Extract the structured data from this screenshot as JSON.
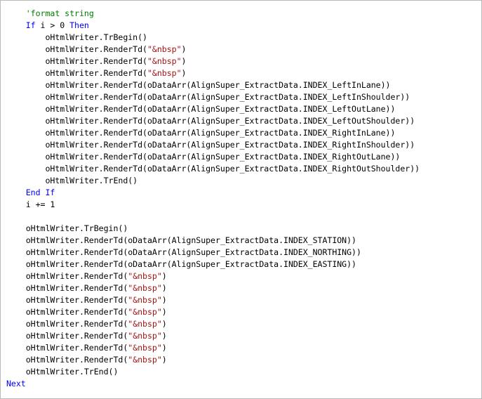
{
  "editor": {
    "lines": [
      [
        {
          "t": "    ",
          "k": "plain"
        },
        {
          "t": "'format string",
          "k": "comment"
        }
      ],
      [
        {
          "t": "    ",
          "k": "plain"
        },
        {
          "t": "If",
          "k": "keyword"
        },
        {
          "t": " i > 0 ",
          "k": "plain"
        },
        {
          "t": "Then",
          "k": "keyword"
        }
      ],
      [
        {
          "t": "        oHtmlWriter.TrBegin()",
          "k": "plain"
        }
      ],
      [
        {
          "t": "        oHtmlWriter.RenderTd(",
          "k": "plain"
        },
        {
          "t": "\"&nbsp\"",
          "k": "string"
        },
        {
          "t": ")",
          "k": "plain"
        }
      ],
      [
        {
          "t": "        oHtmlWriter.RenderTd(",
          "k": "plain"
        },
        {
          "t": "\"&nbsp\"",
          "k": "string"
        },
        {
          "t": ")",
          "k": "plain"
        }
      ],
      [
        {
          "t": "        oHtmlWriter.RenderTd(",
          "k": "plain"
        },
        {
          "t": "\"&nbsp\"",
          "k": "string"
        },
        {
          "t": ")",
          "k": "plain"
        }
      ],
      [
        {
          "t": "        oHtmlWriter.RenderTd(oDataArr(AlignSuper_ExtractData.INDEX_LeftInLane))",
          "k": "plain"
        }
      ],
      [
        {
          "t": "        oHtmlWriter.RenderTd(oDataArr(AlignSuper_ExtractData.INDEX_LeftInShoulder))",
          "k": "plain"
        }
      ],
      [
        {
          "t": "        oHtmlWriter.RenderTd(oDataArr(AlignSuper_ExtractData.INDEX_LeftOutLane))",
          "k": "plain"
        }
      ],
      [
        {
          "t": "        oHtmlWriter.RenderTd(oDataArr(AlignSuper_ExtractData.INDEX_LeftOutShoulder))",
          "k": "plain"
        }
      ],
      [
        {
          "t": "        oHtmlWriter.RenderTd(oDataArr(AlignSuper_ExtractData.INDEX_RightInLane))",
          "k": "plain"
        }
      ],
      [
        {
          "t": "        oHtmlWriter.RenderTd(oDataArr(AlignSuper_ExtractData.INDEX_RightInShoulder))",
          "k": "plain"
        }
      ],
      [
        {
          "t": "        oHtmlWriter.RenderTd(oDataArr(AlignSuper_ExtractData.INDEX_RightOutLane))",
          "k": "plain"
        }
      ],
      [
        {
          "t": "        oHtmlWriter.RenderTd(oDataArr(AlignSuper_ExtractData.INDEX_RightOutShoulder))",
          "k": "plain"
        }
      ],
      [
        {
          "t": "        oHtmlWriter.TrEnd()",
          "k": "plain"
        }
      ],
      [
        {
          "t": "    ",
          "k": "plain"
        },
        {
          "t": "End If",
          "k": "keyword"
        }
      ],
      [
        {
          "t": "    i += 1",
          "k": "plain"
        }
      ],
      [
        {
          "t": "",
          "k": "plain"
        }
      ],
      [
        {
          "t": "    oHtmlWriter.TrBegin()",
          "k": "plain"
        }
      ],
      [
        {
          "t": "    oHtmlWriter.RenderTd(oDataArr(AlignSuper_ExtractData.INDEX_STATION))",
          "k": "plain"
        }
      ],
      [
        {
          "t": "    oHtmlWriter.RenderTd(oDataArr(AlignSuper_ExtractData.INDEX_NORTHING))",
          "k": "plain"
        }
      ],
      [
        {
          "t": "    oHtmlWriter.RenderTd(oDataArr(AlignSuper_ExtractData.INDEX_EASTING))",
          "k": "plain"
        }
      ],
      [
        {
          "t": "    oHtmlWriter.RenderTd(",
          "k": "plain"
        },
        {
          "t": "\"&nbsp\"",
          "k": "string"
        },
        {
          "t": ")",
          "k": "plain"
        }
      ],
      [
        {
          "t": "    oHtmlWriter.RenderTd(",
          "k": "plain"
        },
        {
          "t": "\"&nbsp\"",
          "k": "string"
        },
        {
          "t": ")",
          "k": "plain"
        }
      ],
      [
        {
          "t": "    oHtmlWriter.RenderTd(",
          "k": "plain"
        },
        {
          "t": "\"&nbsp\"",
          "k": "string"
        },
        {
          "t": ")",
          "k": "plain"
        }
      ],
      [
        {
          "t": "    oHtmlWriter.RenderTd(",
          "k": "plain"
        },
        {
          "t": "\"&nbsp\"",
          "k": "string"
        },
        {
          "t": ")",
          "k": "plain"
        }
      ],
      [
        {
          "t": "    oHtmlWriter.RenderTd(",
          "k": "plain"
        },
        {
          "t": "\"&nbsp\"",
          "k": "string"
        },
        {
          "t": ")",
          "k": "plain"
        }
      ],
      [
        {
          "t": "    oHtmlWriter.RenderTd(",
          "k": "plain"
        },
        {
          "t": "\"&nbsp\"",
          "k": "string"
        },
        {
          "t": ")",
          "k": "plain"
        }
      ],
      [
        {
          "t": "    oHtmlWriter.RenderTd(",
          "k": "plain"
        },
        {
          "t": "\"&nbsp\"",
          "k": "string"
        },
        {
          "t": ")",
          "k": "plain"
        }
      ],
      [
        {
          "t": "    oHtmlWriter.RenderTd(",
          "k": "plain"
        },
        {
          "t": "\"&nbsp\"",
          "k": "string"
        },
        {
          "t": ")",
          "k": "plain"
        }
      ],
      [
        {
          "t": "    oHtmlWriter.TrEnd()",
          "k": "plain"
        }
      ],
      [
        {
          "t": "Next",
          "k": "keyword"
        }
      ]
    ]
  },
  "colors": {
    "comment": "#008000",
    "keyword": "#0000ff",
    "string": "#a31515",
    "plain": "#000000",
    "border": "#b9b9b9",
    "background": "#ffffff"
  }
}
